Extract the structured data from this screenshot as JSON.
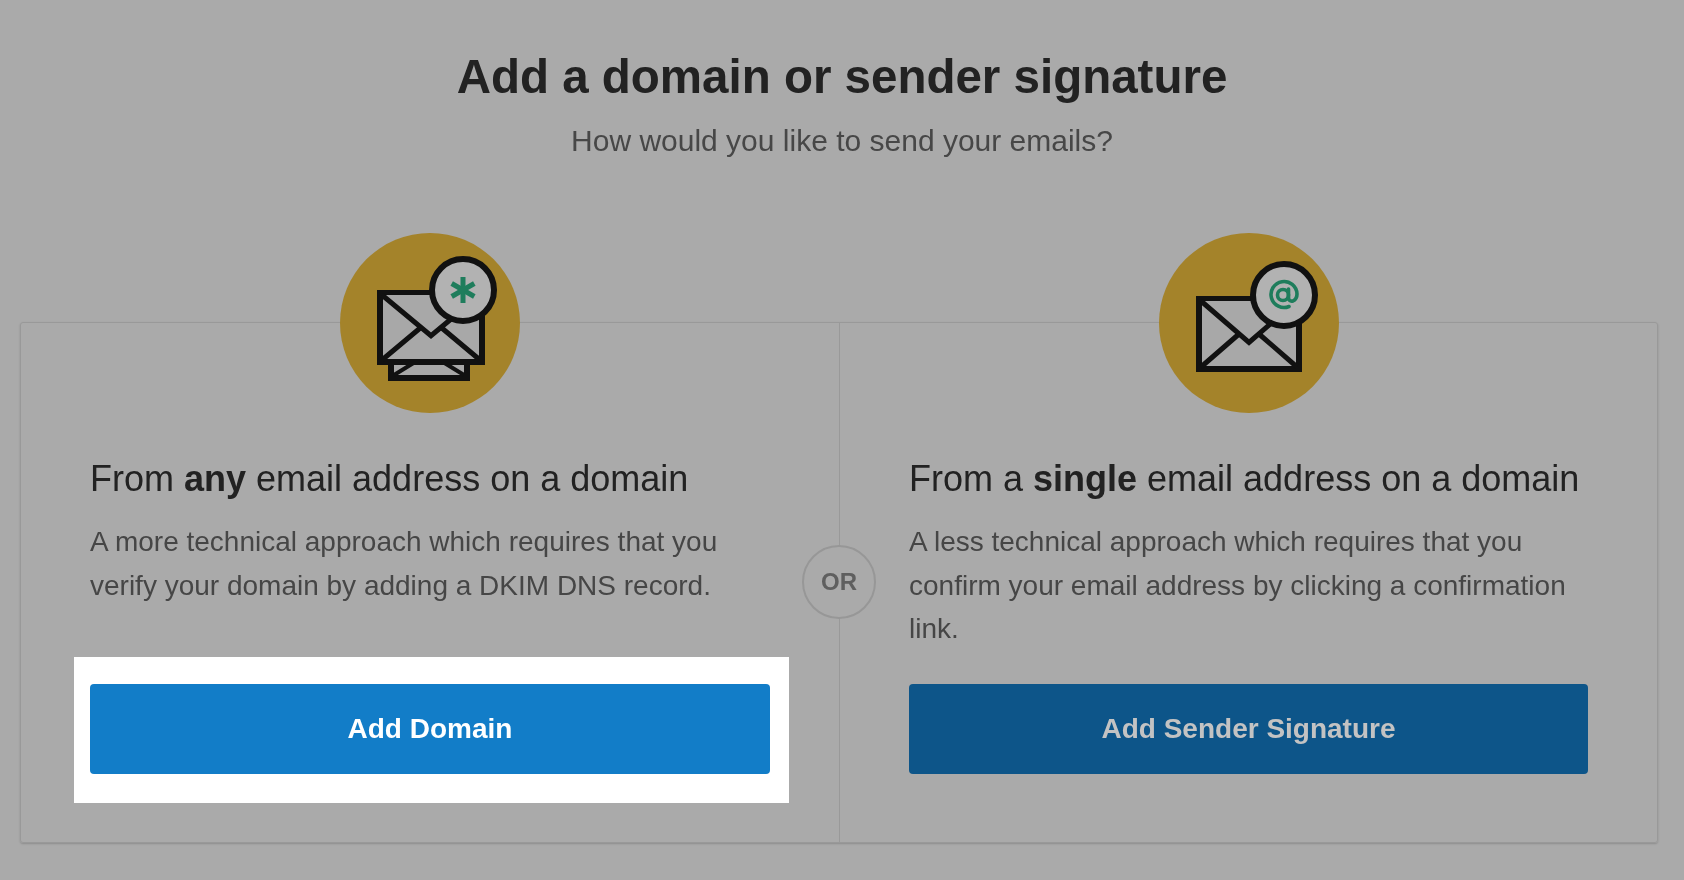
{
  "title": "Add a domain or sender signature",
  "subtitle": "How would you like to send your emails?",
  "options": [
    {
      "kind": "domain",
      "heading": "From **any** email address on a domain",
      "description": "A more technical approach which requires that you verify your domain by adding a DKIM DNS record.",
      "button": "Add Domain",
      "highlighted": true
    },
    {
      "kind": "sender",
      "heading": "From a **single** email address on a domain",
      "description": "A less technical approach which requires that you confirm your email address by clicking a confirmation link.",
      "button": "Add Sender Signature",
      "highlighted": false
    }
  ],
  "separator": "OR"
}
